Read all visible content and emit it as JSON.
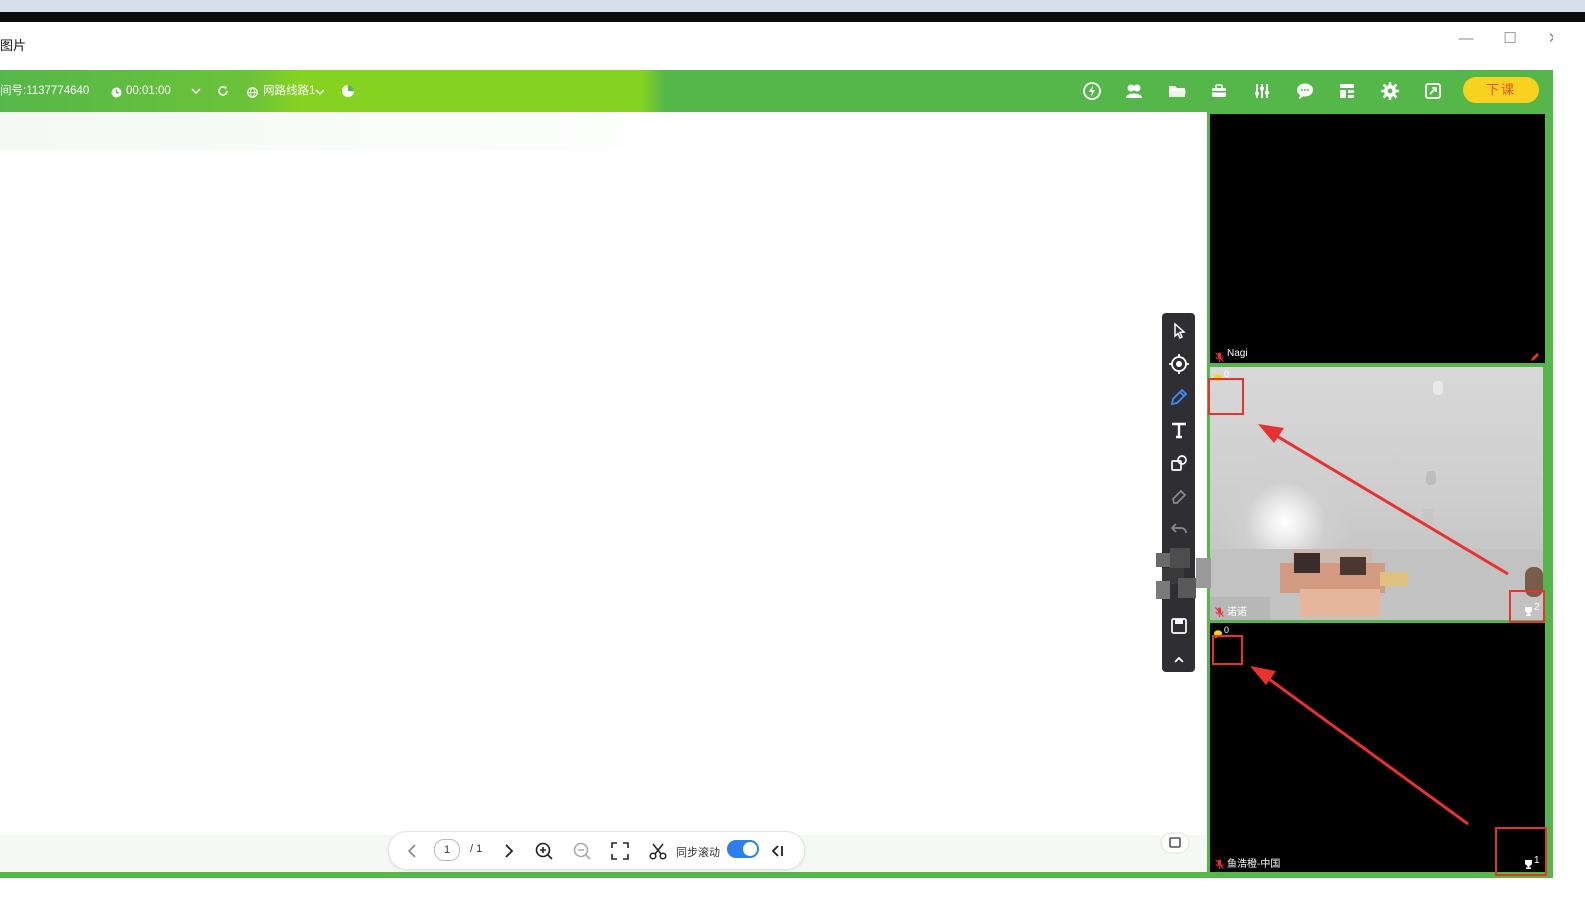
{
  "window": {
    "title": "图片",
    "minimize": "—",
    "maximize": "☐",
    "close": "✕"
  },
  "classbar": {
    "room_number": "间号:1137774640",
    "timer": "00:01:00",
    "network_line": "网路线路1",
    "end_class_label": "下课",
    "tool_icons": [
      "flash-icon",
      "group-icon",
      "folder-icon",
      "toolbox-icon",
      "mixer-icon",
      "chat-icon",
      "layout-icon",
      "gear-icon",
      "fullscreen-icon"
    ]
  },
  "videos": [
    {
      "name": "Nagi",
      "mic": "off"
    },
    {
      "name": "诺诺",
      "mic": "off",
      "raise_count": "0",
      "reward_count": "2"
    },
    {
      "name": "鱼浩橙-中国",
      "mic": "off",
      "raise_count": "0",
      "reward_count": "1"
    }
  ],
  "whiteboard_tools": [
    "pointer-icon",
    "laser-icon",
    "pen-icon",
    "text-icon",
    "shape-icon",
    "eraser-icon",
    "undo-icon",
    "save-icon",
    "collapse-icon"
  ],
  "pager": {
    "current_page": "1",
    "total_pages": "/ 1",
    "sync_scroll_label": "同步滚动",
    "sync_scroll_on": true
  },
  "colors": {
    "accent_green": "#55b74a",
    "end_class_bg": "#f8d21e",
    "annotation_red": "#e8322f",
    "toggle_blue": "#2d7ff0"
  }
}
